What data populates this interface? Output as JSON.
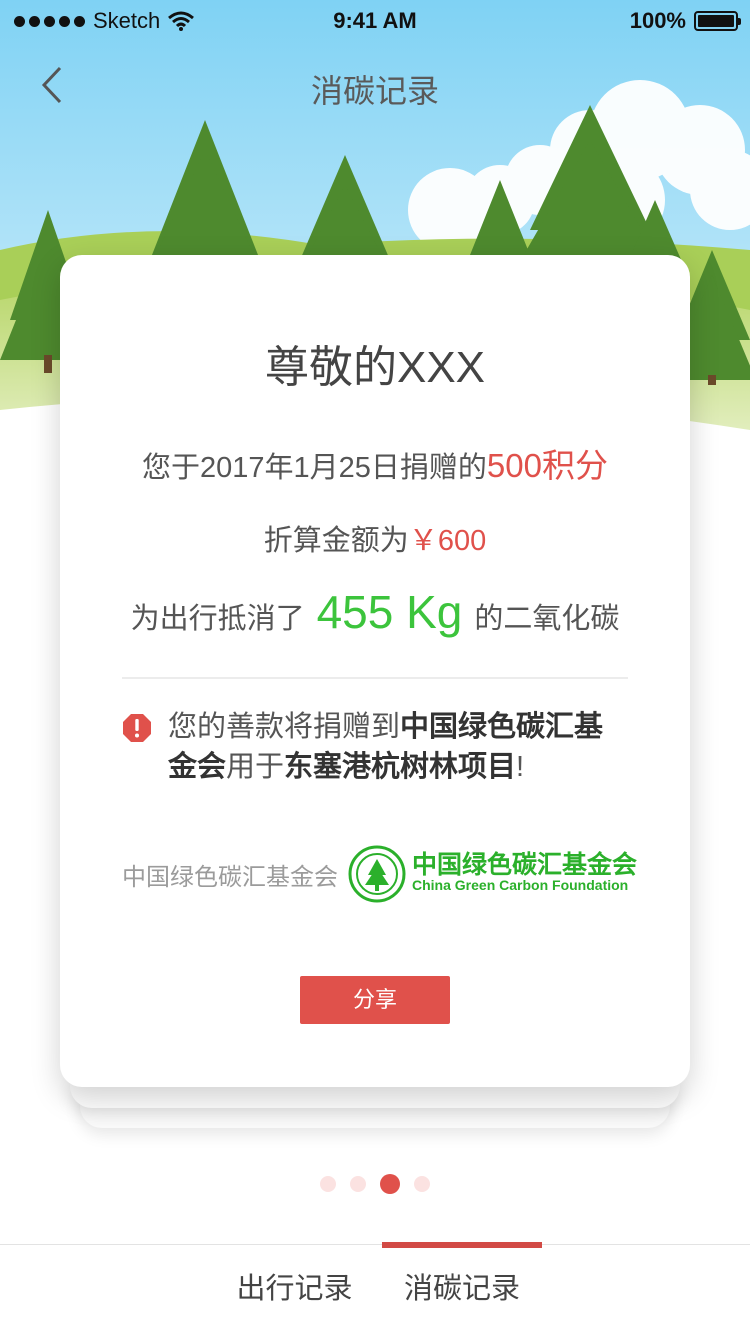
{
  "status_bar": {
    "carrier": "Sketch",
    "time": "9:41 AM",
    "battery": "100%"
  },
  "nav": {
    "title": "消碳记录"
  },
  "card": {
    "greeting": "尊敬的XXX",
    "donation_prefix": "您于2017年1月25日捐赠的",
    "donation_points": "500积分",
    "amount_prefix": "折算金额为",
    "amount_value": "￥600",
    "offset_prefix": "为出行抵消了",
    "offset_value": "455 Kg",
    "offset_suffix": "的二氧化碳",
    "notice_part1": "您的善款将捐赠到",
    "notice_org": "中国绿色碳汇基金会",
    "notice_part2": "用于",
    "notice_project": "东塞港杭树林项目",
    "notice_end": "!",
    "foundation_label": "中国绿色碳汇基金会",
    "logo_cn": "中国绿色碳汇基金会",
    "logo_en": "China Green Carbon Foundation",
    "share_label": "分享"
  },
  "pager": {
    "count": 4,
    "active_index": 2
  },
  "tabs": [
    {
      "label": "出行记录",
      "active": false
    },
    {
      "label": "消碳记录",
      "active": true
    }
  ],
  "colors": {
    "accent_red": "#e0514b",
    "highlight_green": "#3cc43c",
    "logo_green": "#2bb02b"
  }
}
